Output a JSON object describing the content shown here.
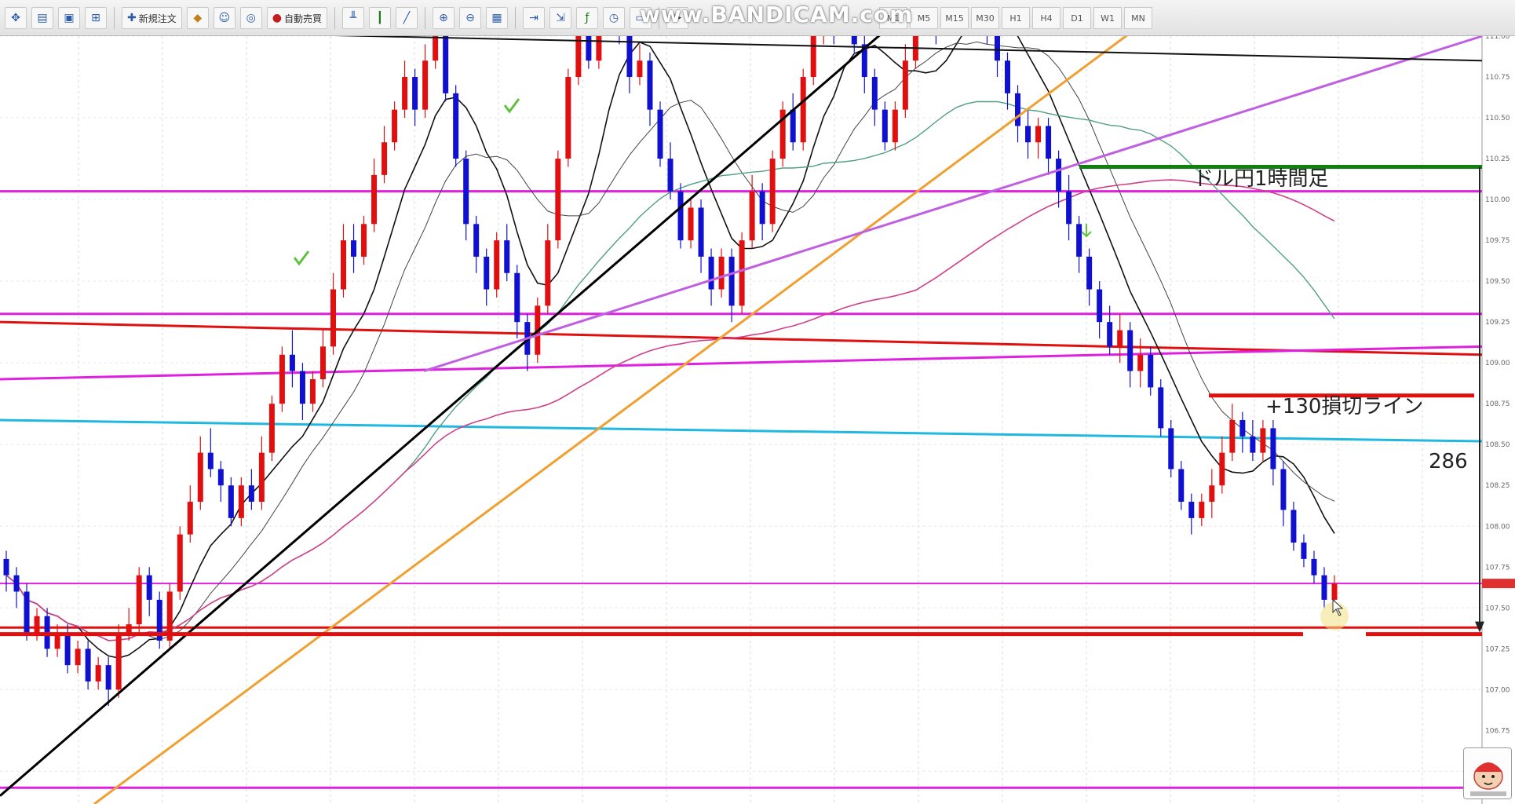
{
  "toolbar": {
    "new_order_label": "新規注文",
    "auto_trade_label": "自動売買",
    "timeframes": [
      "M1",
      "M5",
      "M15",
      "M30",
      "H1",
      "H4",
      "D1",
      "W1",
      "MN"
    ]
  },
  "watermark": "www.BANDICAM.com",
  "colors": {
    "bull": "#e01010",
    "bear": "#1010d0",
    "magenta": "#e020e0",
    "green": "#108010",
    "red_line": "#e01010",
    "cyan": "#20b8e0",
    "orange": "#f0a030",
    "violet": "#c060e0",
    "trend_black": "#000000"
  },
  "annotations": {
    "title": "ドル円1時間足",
    "stop_label": "+130損切ライン",
    "range_label": "286"
  },
  "chart_data": {
    "type": "candlestick",
    "title": "ドル円1時間足",
    "price_range": [
      106.3,
      111.0
    ],
    "levels": {
      "green_entry": 110.2,
      "stop_line": 108.8,
      "target_line": 107.34,
      "cyan_line": 108.57,
      "current_price": 107.65
    },
    "range_pips": 286,
    "candles": [
      [
        107.8,
        107.7,
        107.85,
        107.6
      ],
      [
        107.7,
        107.6,
        107.75,
        107.5
      ],
      [
        107.6,
        107.35,
        107.65,
        107.3
      ],
      [
        107.35,
        107.45,
        107.5,
        107.3
      ],
      [
        107.45,
        107.25,
        107.5,
        107.2
      ],
      [
        107.25,
        107.35,
        107.4,
        107.2
      ],
      [
        107.35,
        107.15,
        107.4,
        107.1
      ],
      [
        107.15,
        107.25,
        107.3,
        107.1
      ],
      [
        107.25,
        107.05,
        107.3,
        107.0
      ],
      [
        107.05,
        107.15,
        107.2,
        107.0
      ],
      [
        107.15,
        107.0,
        107.2,
        106.9
      ],
      [
        107.0,
        107.35,
        107.4,
        106.95
      ],
      [
        107.35,
        107.4,
        107.5,
        107.3
      ],
      [
        107.4,
        107.7,
        107.75,
        107.35
      ],
      [
        107.7,
        107.55,
        107.75,
        107.45
      ],
      [
        107.55,
        107.3,
        107.6,
        107.25
      ],
      [
        107.3,
        107.6,
        107.65,
        107.25
      ],
      [
        107.6,
        107.95,
        108.0,
        107.55
      ],
      [
        107.95,
        108.15,
        108.25,
        107.9
      ],
      [
        108.15,
        108.45,
        108.55,
        108.1
      ],
      [
        108.45,
        108.35,
        108.6,
        108.3
      ],
      [
        108.35,
        108.25,
        108.4,
        108.15
      ],
      [
        108.25,
        108.05,
        108.3,
        108.0
      ],
      [
        108.05,
        108.25,
        108.3,
        108.0
      ],
      [
        108.25,
        108.15,
        108.35,
        108.1
      ],
      [
        108.15,
        108.45,
        108.55,
        108.1
      ],
      [
        108.45,
        108.75,
        108.8,
        108.4
      ],
      [
        108.75,
        109.05,
        109.1,
        108.7
      ],
      [
        109.05,
        108.95,
        109.2,
        108.85
      ],
      [
        108.95,
        108.75,
        109.0,
        108.65
      ],
      [
        108.75,
        108.9,
        108.95,
        108.7
      ],
      [
        108.9,
        109.1,
        109.2,
        108.85
      ],
      [
        109.1,
        109.45,
        109.55,
        109.05
      ],
      [
        109.45,
        109.75,
        109.85,
        109.4
      ],
      [
        109.75,
        109.65,
        109.85,
        109.55
      ],
      [
        109.65,
        109.85,
        109.9,
        109.6
      ],
      [
        109.85,
        110.15,
        110.25,
        109.8
      ],
      [
        110.15,
        110.35,
        110.45,
        110.1
      ],
      [
        110.35,
        110.55,
        110.6,
        110.3
      ],
      [
        110.55,
        110.75,
        110.85,
        110.5
      ],
      [
        110.75,
        110.55,
        110.8,
        110.45
      ],
      [
        110.55,
        110.85,
        110.95,
        110.5
      ],
      [
        110.85,
        111.05,
        111.15,
        110.8
      ],
      [
        111.05,
        110.65,
        111.1,
        110.6
      ],
      [
        110.65,
        110.25,
        110.7,
        110.2
      ],
      [
        110.25,
        109.85,
        110.3,
        109.75
      ],
      [
        109.85,
        109.65,
        109.9,
        109.55
      ],
      [
        109.65,
        109.45,
        109.7,
        109.35
      ],
      [
        109.45,
        109.75,
        109.8,
        109.4
      ],
      [
        109.75,
        109.55,
        109.85,
        109.5
      ],
      [
        109.55,
        109.25,
        109.6,
        109.15
      ],
      [
        109.25,
        109.05,
        109.3,
        108.95
      ],
      [
        109.05,
        109.35,
        109.4,
        109.0
      ],
      [
        109.35,
        109.75,
        109.85,
        109.3
      ],
      [
        109.75,
        110.25,
        110.3,
        109.7
      ],
      [
        110.25,
        110.75,
        110.8,
        110.2
      ],
      [
        110.75,
        111.05,
        111.1,
        110.7
      ],
      [
        111.05,
        110.85,
        111.15,
        110.8
      ],
      [
        110.85,
        111.15,
        111.25,
        110.8
      ],
      [
        111.15,
        111.25,
        111.35,
        111.05
      ],
      [
        111.25,
        111.05,
        111.3,
        110.95
      ],
      [
        111.05,
        110.75,
        111.1,
        110.65
      ],
      [
        110.75,
        110.85,
        110.95,
        110.7
      ],
      [
        110.85,
        110.55,
        110.9,
        110.45
      ],
      [
        110.55,
        110.25,
        110.6,
        110.2
      ],
      [
        110.25,
        110.05,
        110.35,
        110.0
      ],
      [
        110.05,
        109.75,
        110.1,
        109.7
      ],
      [
        109.75,
        109.95,
        110.0,
        109.7
      ],
      [
        109.95,
        109.65,
        110.0,
        109.55
      ],
      [
        109.65,
        109.45,
        109.7,
        109.35
      ],
      [
        109.45,
        109.65,
        109.7,
        109.4
      ],
      [
        109.65,
        109.35,
        109.7,
        109.25
      ],
      [
        109.35,
        109.75,
        109.8,
        109.3
      ],
      [
        109.75,
        110.05,
        110.15,
        109.7
      ],
      [
        110.05,
        109.85,
        110.1,
        109.75
      ],
      [
        109.85,
        110.25,
        110.3,
        109.8
      ],
      [
        110.25,
        110.55,
        110.6,
        110.2
      ],
      [
        110.55,
        110.35,
        110.65,
        110.3
      ],
      [
        110.35,
        110.75,
        110.8,
        110.3
      ],
      [
        110.75,
        111.0,
        111.05,
        110.7
      ],
      [
        111.0,
        111.25,
        111.35,
        110.95
      ],
      [
        111.25,
        111.05,
        111.3,
        110.95
      ],
      [
        111.05,
        111.25,
        111.35,
        111.0
      ],
      [
        111.25,
        110.95,
        111.3,
        110.9
      ],
      [
        110.95,
        110.75,
        111.0,
        110.65
      ],
      [
        110.75,
        110.55,
        110.8,
        110.45
      ],
      [
        110.55,
        110.35,
        110.6,
        110.3
      ],
      [
        110.35,
        110.55,
        110.6,
        110.3
      ],
      [
        110.55,
        110.85,
        110.95,
        110.5
      ],
      [
        110.85,
        111.05,
        111.15,
        110.8
      ],
      [
        111.05,
        111.15,
        111.25,
        111.0
      ],
      [
        111.15,
        111.05,
        111.2,
        110.95
      ],
      [
        111.05,
        111.25,
        111.3,
        111.0
      ],
      [
        111.25,
        111.35,
        111.45,
        111.2
      ],
      [
        111.35,
        111.15,
        111.4,
        111.1
      ],
      [
        111.15,
        111.25,
        111.3,
        111.05
      ],
      [
        111.25,
        111.05,
        111.3,
        110.95
      ],
      [
        111.05,
        110.85,
        111.1,
        110.75
      ],
      [
        110.85,
        110.65,
        110.9,
        110.55
      ],
      [
        110.65,
        110.45,
        110.7,
        110.35
      ],
      [
        110.45,
        110.35,
        110.55,
        110.25
      ],
      [
        110.35,
        110.45,
        110.5,
        110.25
      ],
      [
        110.45,
        110.25,
        110.5,
        110.15
      ],
      [
        110.25,
        110.05,
        110.3,
        109.95
      ],
      [
        110.05,
        109.85,
        110.15,
        109.75
      ],
      [
        109.85,
        109.65,
        109.9,
        109.55
      ],
      [
        109.65,
        109.45,
        109.7,
        109.35
      ],
      [
        109.45,
        109.25,
        109.5,
        109.15
      ],
      [
        109.25,
        109.1,
        109.35,
        109.05
      ],
      [
        109.1,
        109.2,
        109.3,
        109.0
      ],
      [
        109.2,
        108.95,
        109.25,
        108.85
      ],
      [
        108.95,
        109.05,
        109.15,
        108.85
      ],
      [
        109.05,
        108.85,
        109.1,
        108.8
      ],
      [
        108.85,
        108.6,
        108.9,
        108.55
      ],
      [
        108.6,
        108.35,
        108.65,
        108.3
      ],
      [
        108.35,
        108.15,
        108.4,
        108.1
      ],
      [
        108.15,
        108.05,
        108.2,
        107.95
      ],
      [
        108.05,
        108.15,
        108.2,
        108.0
      ],
      [
        108.15,
        108.25,
        108.35,
        108.05
      ],
      [
        108.25,
        108.45,
        108.55,
        108.2
      ],
      [
        108.45,
        108.65,
        108.75,
        108.4
      ],
      [
        108.65,
        108.55,
        108.7,
        108.45
      ],
      [
        108.55,
        108.45,
        108.65,
        108.4
      ],
      [
        108.45,
        108.6,
        108.65,
        108.4
      ],
      [
        108.6,
        108.35,
        108.65,
        108.25
      ],
      [
        108.35,
        108.1,
        108.4,
        108.0
      ],
      [
        108.1,
        107.9,
        108.15,
        107.85
      ],
      [
        107.9,
        107.8,
        107.95,
        107.75
      ],
      [
        107.8,
        107.7,
        107.85,
        107.65
      ],
      [
        107.7,
        107.55,
        107.75,
        107.5
      ],
      [
        107.55,
        107.65,
        107.7,
        107.5
      ]
    ]
  }
}
